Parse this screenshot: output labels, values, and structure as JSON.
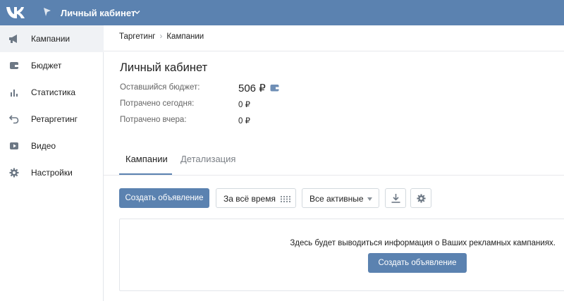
{
  "topbar": {
    "account_title": "Личный кабинет"
  },
  "sidebar": {
    "items": [
      {
        "label": "Кампании",
        "icon": "megaphone-icon",
        "active": true
      },
      {
        "label": "Бюджет",
        "icon": "wallet-icon",
        "active": false
      },
      {
        "label": "Статистика",
        "icon": "bar-chart-icon",
        "active": false
      },
      {
        "label": "Ретаргетинг",
        "icon": "return-arrow-icon",
        "active": false
      },
      {
        "label": "Видео",
        "icon": "video-icon",
        "active": false
      },
      {
        "label": "Настройки",
        "icon": "gear-icon",
        "active": false
      }
    ]
  },
  "breadcrumb": {
    "items": [
      "Таргетинг",
      "Кампании"
    ],
    "separator": "›"
  },
  "page": {
    "title": "Личный кабинет"
  },
  "stats": {
    "remaining_label": "Оставшийся бюджет:",
    "remaining_value": "506 ₽",
    "spent_today_label": "Потрачено сегодня:",
    "spent_today_value": "0 ₽",
    "spent_yesterday_label": "Потрачено вчера:",
    "spent_yesterday_value": "0 ₽"
  },
  "tabs": [
    {
      "label": "Кампании",
      "active": true
    },
    {
      "label": "Детализация",
      "active": false
    }
  ],
  "toolbar": {
    "create_label": "Создать объявление",
    "period_label": "За всё время",
    "status_label": "Все активные"
  },
  "empty_state": {
    "message": "Здесь будет выводиться информация о Ваших рекламных кампаниях.",
    "create_label": "Создать объявление"
  },
  "colors": {
    "brand": "#5b82b0",
    "sidebar_active": "#f0f2f5",
    "border": "#d3d9de"
  }
}
